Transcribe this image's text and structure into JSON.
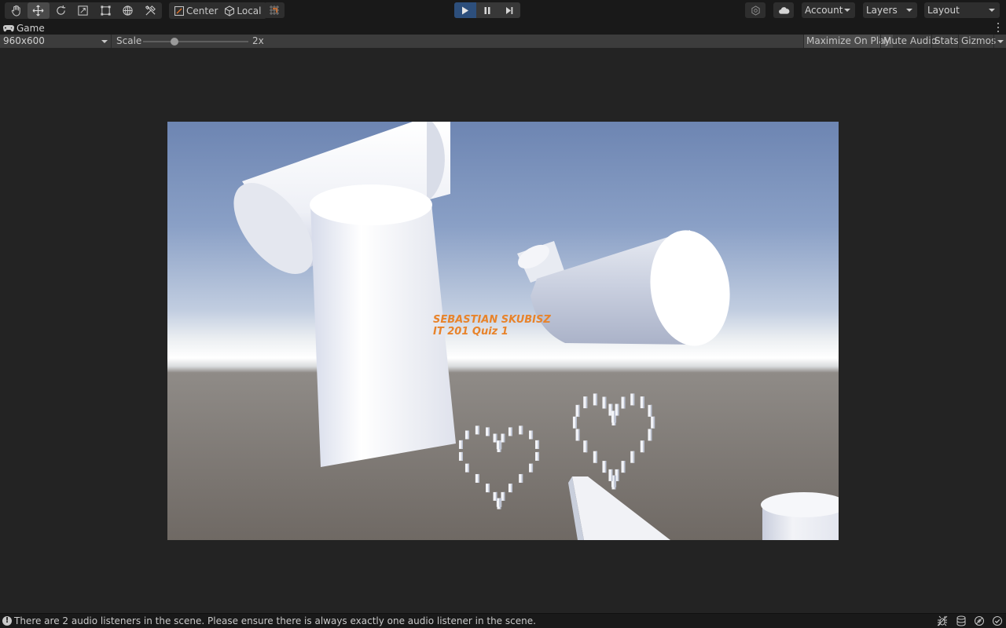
{
  "toolbar": {
    "tools": [
      {
        "name": "hand-tool",
        "icon": "hand-icon"
      },
      {
        "name": "move-tool",
        "icon": "move-icon",
        "active": true
      },
      {
        "name": "rotate-tool",
        "icon": "rotate-icon"
      },
      {
        "name": "scale-tool",
        "icon": "scale-icon"
      },
      {
        "name": "rect-tool",
        "icon": "rect-transform-icon"
      },
      {
        "name": "transform-tool",
        "icon": "transform-icon"
      },
      {
        "name": "custom-tool",
        "icon": "custom-tools-icon"
      }
    ],
    "pivot_position_label": "Center",
    "pivot_rotation_label": "Local",
    "grid_snap_icon": "grid-snap-icon",
    "play_icon": "play-icon",
    "pause_icon": "pause-icon",
    "step_icon": "step-icon",
    "account_label": "Account",
    "layers_label": "Layers",
    "layout_label": "Layout",
    "accent_color": "#2d4f7c"
  },
  "tab": {
    "game_label": "Game",
    "game_icon": "gamepad-icon"
  },
  "view_toolbar": {
    "resolution": "960x600",
    "scale_label": "Scale",
    "scale_value": "2x",
    "scale_fraction": 0.3,
    "maximize_label": "Maximize On Play",
    "mute_label": "Mute Audio",
    "stats_label": "Stats",
    "gizmos_label": "Gizmos"
  },
  "game": {
    "line1": "SEBASTIAN SKUBISZ",
    "line2": "IT 201 Quiz 1",
    "text_color": "#e8832a"
  },
  "status": {
    "message": "There are 2 audio listeners in the scene. Please ensure there is always exactly one audio listener in the scene."
  }
}
